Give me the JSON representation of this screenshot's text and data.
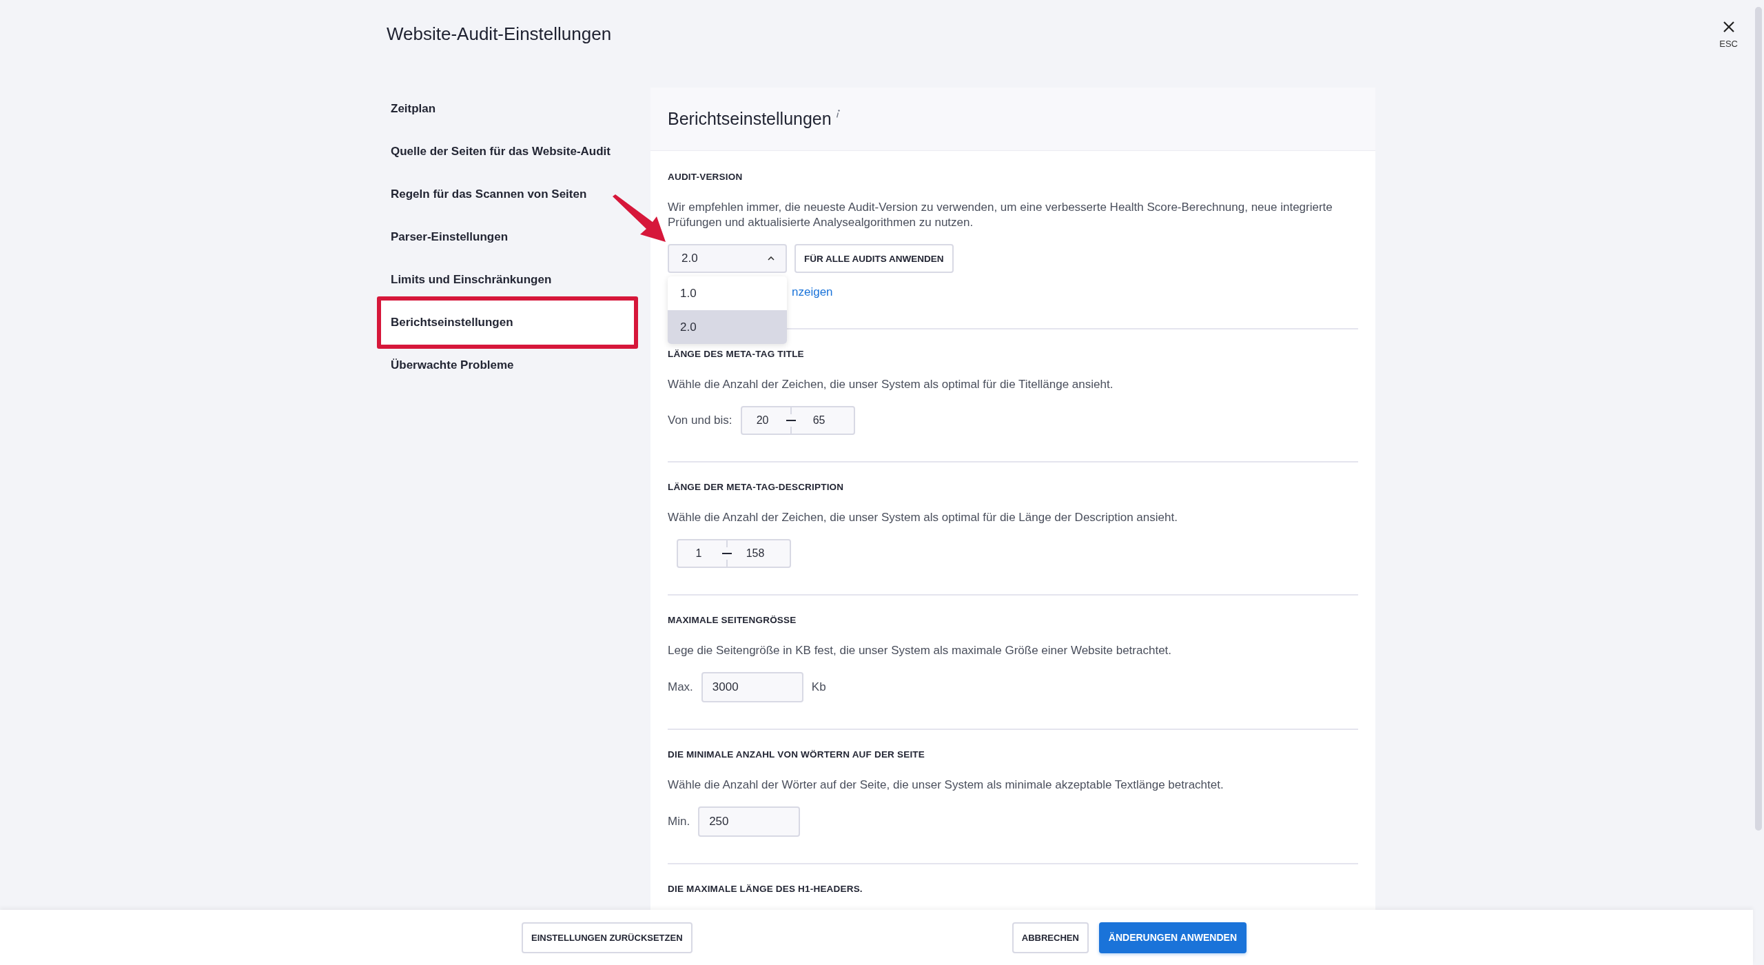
{
  "title": "Website-Audit-Einstellungen",
  "close": {
    "label": "ESC"
  },
  "sidebar": {
    "items": [
      {
        "label": "Zeitplan",
        "selected": false
      },
      {
        "label": "Quelle der Seiten für das Website-Audit",
        "selected": false
      },
      {
        "label": "Regeln für das Scannen von Seiten",
        "selected": false
      },
      {
        "label": "Parser-Einstellungen",
        "selected": false
      },
      {
        "label": "Limits und Einschränkungen",
        "selected": false
      },
      {
        "label": "Berichtseinstellungen",
        "selected": true
      },
      {
        "label": "Überwachte Probleme",
        "selected": false
      }
    ]
  },
  "panel": {
    "heading": "Berichtseinstellungen",
    "sections": [
      {
        "kind": "version",
        "label": "AUDIT-VERSION",
        "description": "Wir empfehlen immer, die neueste Audit-Version zu verwenden, um eine verbesserte Health Score-Berechnung, neue integrierte Prüfungen und aktualisierte Analysealgorithmen zu nutzen.",
        "select": {
          "value": "2.0",
          "expanded": true,
          "options": [
            {
              "label": "1.0",
              "selected": false
            },
            {
              "label": "2.0",
              "selected": true
            }
          ]
        },
        "button": "FÜR ALLE AUDITS ANWENDEN",
        "link": "nzeigen"
      },
      {
        "kind": "range",
        "label": "LÄNGE DES META-TAG TITLE",
        "description": "Wähle die Anzahl der Zeichen, die unser System als optimal für die Titellänge ansieht.",
        "prefix": "Von und bis:",
        "from": "20",
        "to": "65"
      },
      {
        "kind": "range",
        "label": "LÄNGE DER META-TAG-DESCRIPTION",
        "description": "Wähle die Anzahl der Zeichen, die unser System als optimal für die Länge der Description ansieht.",
        "from": "1",
        "to": "158"
      },
      {
        "kind": "number",
        "label": "MAXIMALE SEITENGRÖSSE",
        "description": "Lege die Seitengröße in KB fest, die unser System als maximale Größe einer Website betrachtet.",
        "prefix": "Max.",
        "value": "3000",
        "suffix": "Kb"
      },
      {
        "kind": "number",
        "label": "DIE MINIMALE ANZAHL VON WÖRTERN AUF DER SEITE",
        "description": "Wähle die Anzahl der Wörter auf der Seite, die unser System als minimale akzeptable Textlänge betrachtet.",
        "prefix": "Min.",
        "value": "250"
      },
      {
        "kind": "label",
        "label": "DIE MAXIMALE LÄNGE DES H1-HEADERS."
      }
    ]
  },
  "footer": {
    "reset": "EINSTELLUNGEN ZURÜCKSETZEN",
    "cancel": "ABBRECHEN",
    "apply": "ÄNDERUNGEN ANWENDEN"
  }
}
